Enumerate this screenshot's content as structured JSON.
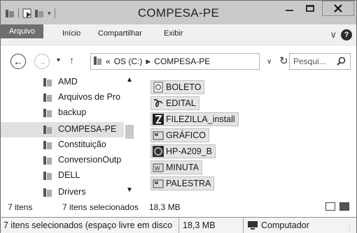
{
  "window": {
    "title": "COMPESA-PE"
  },
  "ribbon": {
    "tabs": [
      "Arquivo",
      "Início",
      "Compartilhar",
      "Exibir"
    ]
  },
  "address": {
    "overflow": "«",
    "crumbs": [
      "OS (C:)",
      "COMPESA-PE"
    ],
    "search_placeholder": "Pesqui..."
  },
  "navpane": {
    "items": [
      {
        "label": "AMD",
        "selected": false
      },
      {
        "label": "Arquivos de Pro",
        "selected": false
      },
      {
        "label": "backup",
        "selected": false
      },
      {
        "label": "COMPESA-PE",
        "selected": true
      },
      {
        "label": "Constituição",
        "selected": false
      },
      {
        "label": "ConversionOutp",
        "selected": false
      },
      {
        "label": "DELL",
        "selected": false
      },
      {
        "label": "Drivers",
        "selected": false
      }
    ]
  },
  "files": [
    {
      "name": "BOLETO",
      "icon": "document-icon"
    },
    {
      "name": "EDITAL",
      "icon": "pdf-icon"
    },
    {
      "name": "FILEZILLA_install",
      "icon": "filezilla-icon"
    },
    {
      "name": "GRÁFICO",
      "icon": "image-icon"
    },
    {
      "name": "HP-A209_B",
      "icon": "hp-icon"
    },
    {
      "name": "MINUTA",
      "icon": "word-icon"
    },
    {
      "name": "PALESTRA",
      "icon": "image-icon"
    }
  ],
  "status": {
    "count": "7 itens",
    "selected": "7 itens selecionados",
    "size": "18,3 MB"
  },
  "bottom": {
    "selection_info": "7 itens selecionados (espaço livre em disco",
    "size": "18,3 MB",
    "location": "Computador"
  }
}
